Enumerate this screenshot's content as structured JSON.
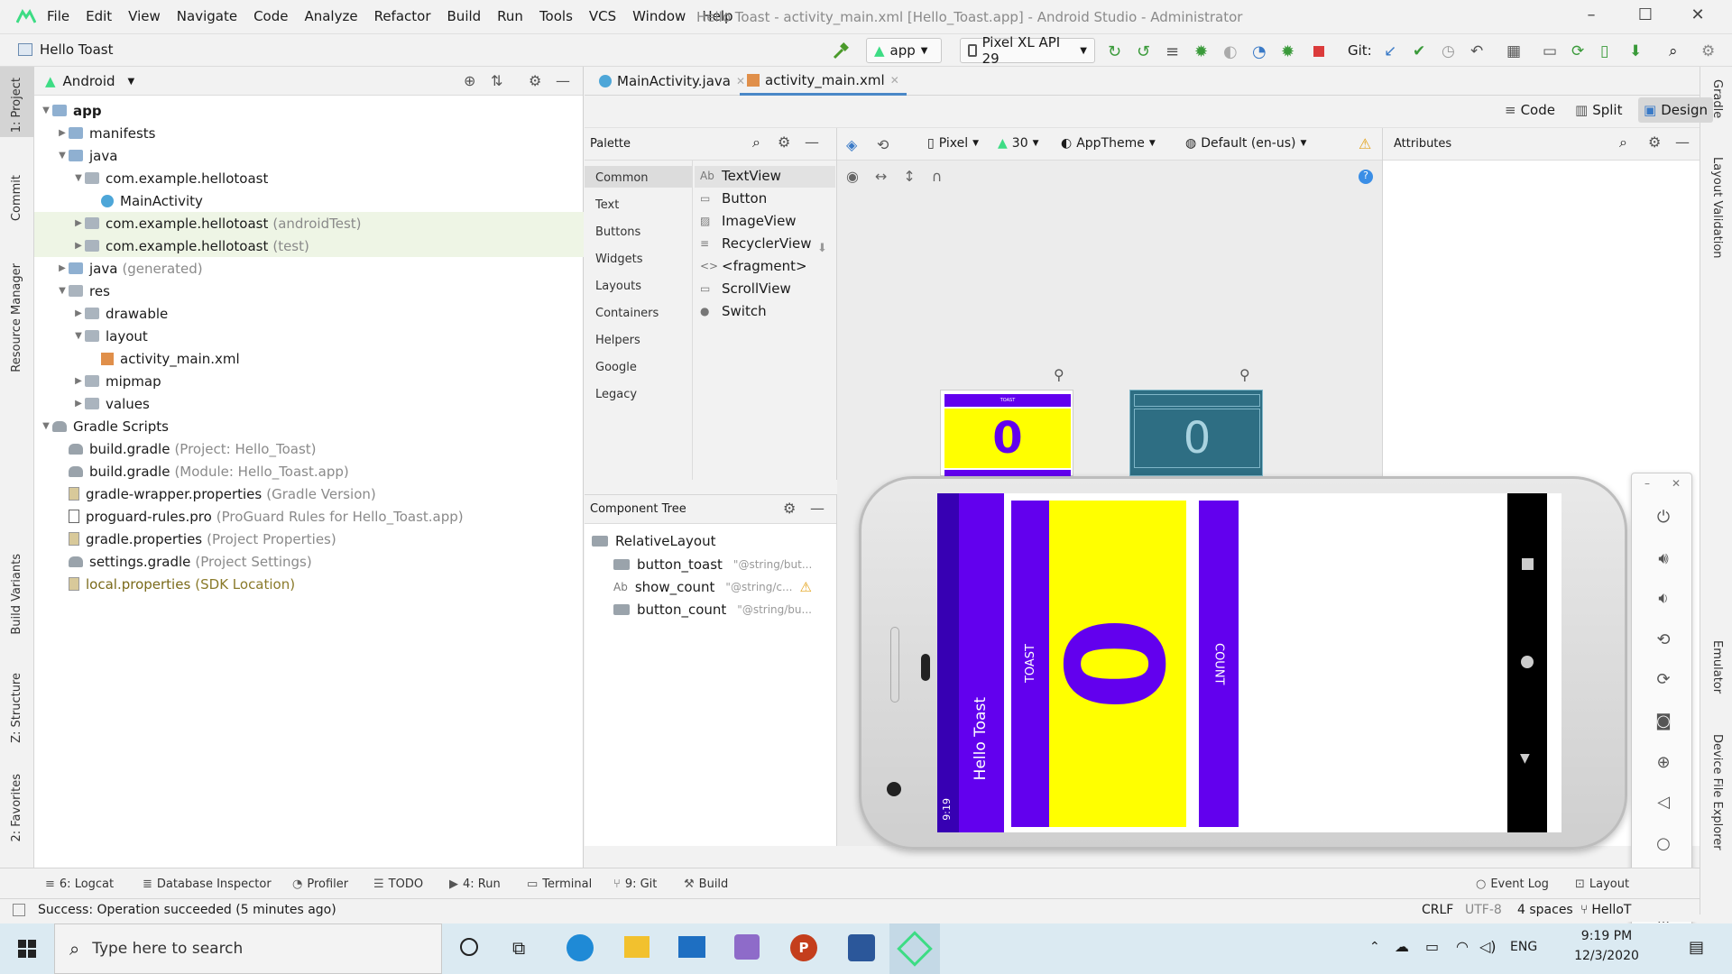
{
  "window": {
    "title": "Hello Toast - activity_main.xml [Hello_Toast.app] - Android Studio - Administrator",
    "menu": [
      "File",
      "Edit",
      "View",
      "Navigate",
      "Code",
      "Analyze",
      "Refactor",
      "Build",
      "Run",
      "Tools",
      "VCS",
      "Window",
      "Help"
    ]
  },
  "navbar": {
    "project_name": "Hello Toast",
    "run_config": "app",
    "device": "Pixel XL API 29",
    "git_label": "Git:"
  },
  "left_stripe": [
    "1: Project",
    "Commit",
    "Resource Manager",
    "Build Variants",
    "Z: Structure",
    "2: Favorites"
  ],
  "right_stripe": [
    "Gradle",
    "Layout Validation",
    "Emulator",
    "Device File Explorer"
  ],
  "project_panel": {
    "view_mode": "Android",
    "tree": [
      {
        "label": "app",
        "bold": true,
        "level": 0,
        "arrow": "▼",
        "icon": "folder"
      },
      {
        "label": "manifests",
        "level": 1,
        "arrow": "▶",
        "icon": "folder"
      },
      {
        "label": "java",
        "level": 1,
        "arrow": "▼",
        "icon": "folder"
      },
      {
        "label": "com.example.hellotoast",
        "level": 2,
        "arrow": "▼",
        "icon": "package"
      },
      {
        "label": "MainActivity",
        "level": 3,
        "arrow": "",
        "icon": "class"
      },
      {
        "label": "com.example.hellotoast",
        "suffix": "(androidTest)",
        "level": 2,
        "arrow": "▶",
        "icon": "package",
        "hl": true
      },
      {
        "label": "com.example.hellotoast",
        "suffix": "(test)",
        "level": 2,
        "arrow": "▶",
        "icon": "package",
        "hl": true
      },
      {
        "label": "java",
        "suffix": "(generated)",
        "level": 1,
        "arrow": "▶",
        "icon": "folder"
      },
      {
        "label": "res",
        "level": 1,
        "arrow": "▼",
        "icon": "res"
      },
      {
        "label": "drawable",
        "level": 2,
        "arrow": "▶",
        "icon": "package"
      },
      {
        "label": "layout",
        "level": 2,
        "arrow": "▼",
        "icon": "package"
      },
      {
        "label": "activity_main.xml",
        "level": 3,
        "arrow": "",
        "icon": "xml"
      },
      {
        "label": "mipmap",
        "level": 2,
        "arrow": "▶",
        "icon": "package"
      },
      {
        "label": "values",
        "level": 2,
        "arrow": "▶",
        "icon": "package"
      },
      {
        "label": "Gradle Scripts",
        "level": 0,
        "arrow": "▼",
        "icon": "gradle"
      },
      {
        "label": "build.gradle",
        "suffix": "(Project: Hello_Toast)",
        "level": 1,
        "arrow": "",
        "icon": "gradle"
      },
      {
        "label": "build.gradle",
        "suffix": "(Module: Hello_Toast.app)",
        "level": 1,
        "arrow": "",
        "icon": "gradle"
      },
      {
        "label": "gradle-wrapper.properties",
        "suffix": "(Gradle Version)",
        "level": 1,
        "arrow": "",
        "icon": "props"
      },
      {
        "label": "proguard-rules.pro",
        "suffix": "(ProGuard Rules for Hello_Toast.app)",
        "level": 1,
        "arrow": "",
        "icon": "file"
      },
      {
        "label": "gradle.properties",
        "suffix": "(Project Properties)",
        "level": 1,
        "arrow": "",
        "icon": "props"
      },
      {
        "label": "settings.gradle",
        "suffix": "(Project Settings)",
        "level": 1,
        "arrow": "",
        "icon": "gradle"
      },
      {
        "label": "local.properties",
        "suffix": "(SDK Location)",
        "level": 1,
        "arrow": "",
        "icon": "props",
        "olive": true
      }
    ]
  },
  "editor_tabs": [
    "MainActivity.java",
    "activity_main.xml"
  ],
  "view_modes": [
    "Code",
    "Split",
    "Design"
  ],
  "palette": {
    "title": "Palette",
    "categories": [
      "Common",
      "Text",
      "Buttons",
      "Widgets",
      "Layouts",
      "Containers",
      "Helpers",
      "Google",
      "Legacy"
    ],
    "items": [
      "TextView",
      "Button",
      "ImageView",
      "RecyclerView",
      "<fragment>",
      "ScrollView",
      "Switch"
    ]
  },
  "design_toolbar": {
    "device": "Pixel",
    "api": "30",
    "theme": "AppTheme",
    "locale": "Default (en-us)"
  },
  "attributes_title": "Attributes",
  "component_tree": {
    "title": "Component Tree",
    "root": "RelativeLayout",
    "children": [
      {
        "id": "button_toast",
        "value": "\"@string/but...",
        "icon": "button"
      },
      {
        "id": "show_count",
        "value": "\"@string/c...",
        "icon": "text",
        "warn": true
      },
      {
        "id": "button_count",
        "value": "\"@string/bu...",
        "icon": "button"
      }
    ]
  },
  "preview": {
    "count": "0",
    "small_label": "TOAST"
  },
  "emulator": {
    "status_time": "9:19",
    "app_title": "Hello Toast",
    "toast_button": "TOAST",
    "count_button": "COUNT",
    "count": "0"
  },
  "tool_windows": [
    "6: Logcat",
    "Database Inspector",
    "Profiler",
    "TODO",
    "4: Run",
    "Terminal",
    "9: Git",
    "Build",
    "Event Log",
    "Layout"
  ],
  "status_bar": {
    "message": "Success: Operation succeeded (5 minutes ago)",
    "line_sep": "CRLF",
    "encoding": "UTF-8",
    "indent": "4 spaces",
    "branch": "HelloT"
  },
  "taskbar": {
    "search_placeholder": "Type here to search",
    "lang": "ENG",
    "time": "9:19 PM",
    "date": "12/3/2020"
  },
  "colors": {
    "purple": "#6200ee",
    "yellow": "#ffff00",
    "accent": "#4a88c7"
  }
}
